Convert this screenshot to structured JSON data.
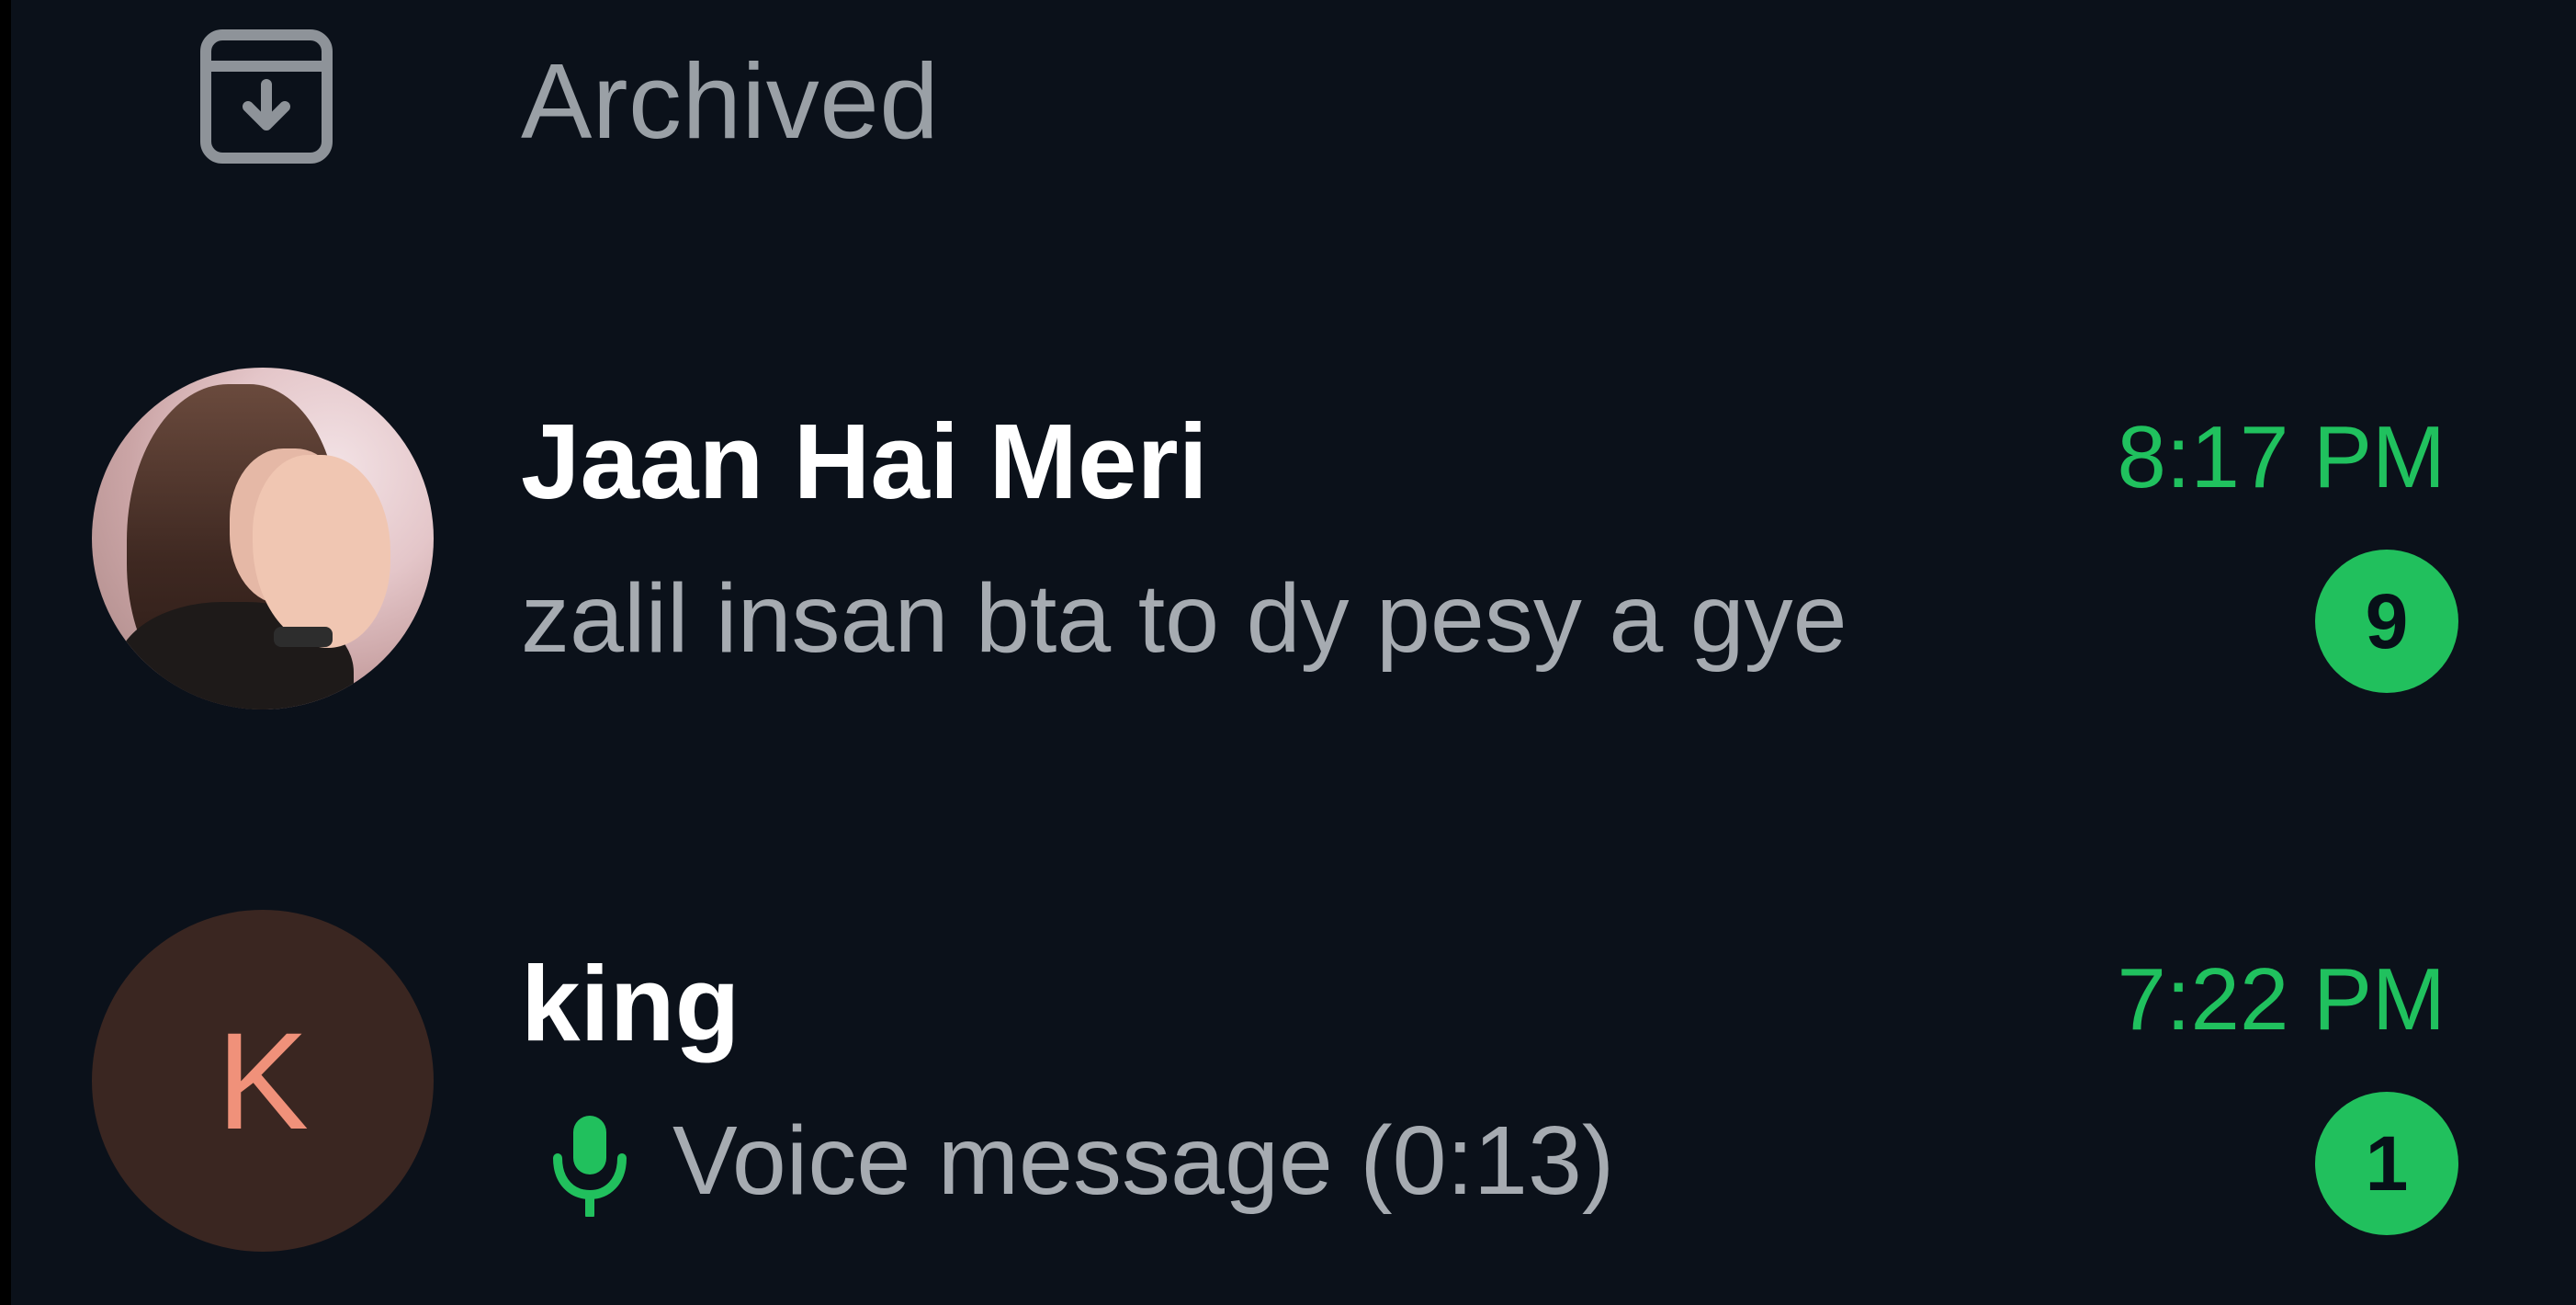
{
  "archived": {
    "label": "Archived",
    "icon": "archive-icon"
  },
  "chats": [
    {
      "name": "Jaan Hai Meri",
      "preview": "zalil insan bta to dy pesy a gye",
      "time": "8:17 PM",
      "unread": "9",
      "avatar": "photo"
    },
    {
      "name": "king",
      "preview": "Voice message (0:13)",
      "preview_icon": "mic-icon",
      "time": "7:22 PM",
      "unread": "1",
      "avatar_letter": "K"
    }
  ],
  "colors": {
    "background": "#0b111a",
    "accent": "#21c05d",
    "muted_text": "#a6abb1",
    "name_text": "#ffffff",
    "letter_avatar_bg": "#3a2621",
    "letter_avatar_fg": "#f0917a"
  }
}
